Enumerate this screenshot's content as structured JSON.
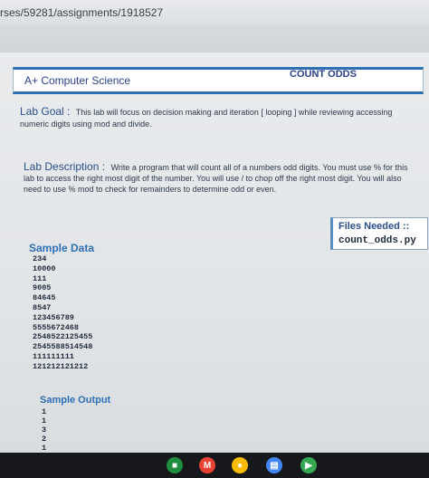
{
  "browser": {
    "url": "rses/59281/assignments/1918527"
  },
  "header": {
    "left": "A+ Computer Science",
    "right": "COUNT ODDS"
  },
  "goal": {
    "heading": "Lab Goal :",
    "text": "This lab will focus on decision making and iteration [ looping ] while reviewing accessing numeric digits using mod and divide."
  },
  "description": {
    "heading": "Lab Description :",
    "text": "Write a program that will count all of a numbers odd digits. You must use % for this lab to access the right most digit of the number. You will use / to chop off the right most digit. You will also need to use % mod to check for remainders to determine odd or even."
  },
  "files": {
    "title": "Files Needed ::",
    "file": "count_odds.py"
  },
  "sample_data": {
    "title": "Sample Data",
    "values": [
      "234",
      "10000",
      "111",
      "9005",
      "84645",
      "8547",
      "123456789",
      "5555672468",
      "2548522125455",
      "2545588514548",
      "111111111",
      "121212121212"
    ]
  },
  "sample_output": {
    "title": "Sample Output",
    "values": [
      "1",
      "1",
      "3",
      "2",
      "1"
    ]
  },
  "colors": {
    "accent": "#2f6fb3",
    "heading": "#2a4e8a"
  },
  "dock": [
    {
      "icon": "classroom-icon",
      "color": "#1e8e3e"
    },
    {
      "icon": "gmail-icon",
      "color": "#ea4335"
    },
    {
      "icon": "chrome-icon",
      "color": "#fbbc05"
    },
    {
      "icon": "docs-icon",
      "color": "#4285f4"
    },
    {
      "icon": "play-store-icon",
      "color": "#34a853"
    }
  ]
}
